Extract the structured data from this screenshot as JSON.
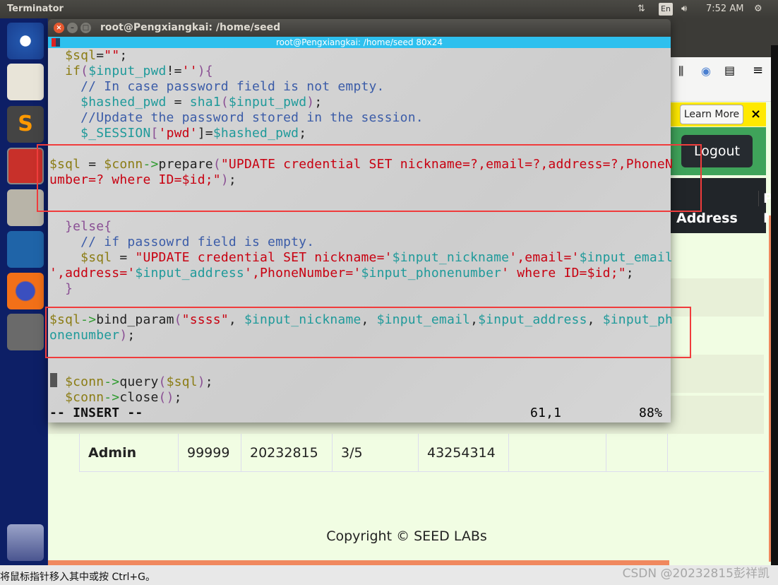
{
  "topbar": {
    "app": "Terminator",
    "keyboard": "En",
    "time": "7:52 AM"
  },
  "launcher": {
    "items": [
      "ubuntu-dash",
      "text-editor",
      "sublime-text",
      "terminator",
      "files",
      "wireshark",
      "firefox",
      "system-settings",
      "trash"
    ]
  },
  "browser": {
    "notification_button": "Learn More",
    "notification_close": "×",
    "logout": "Logout",
    "table_header": [
      "Address",
      "P",
      "N"
    ],
    "admin_row": [
      "Admin",
      "99999",
      "20232815",
      "3/5",
      "43254314",
      "",
      "",
      ""
    ],
    "footer": "Copyright © SEED LABs"
  },
  "terminal": {
    "window_title": "root@Pengxiangkai: /home/seed",
    "tab_title": "root@Pengxiangkai: /home/seed 80x24",
    "lines": [
      [
        [
          "  ",
          "k"
        ],
        [
          "$sql",
          "v"
        ],
        [
          "=",
          "k"
        ],
        [
          "\"\"",
          "s"
        ],
        [
          ";",
          "k"
        ]
      ],
      [
        [
          "  ",
          "k"
        ],
        [
          "if",
          "v"
        ],
        [
          "(",
          "p"
        ],
        [
          "$input_pwd",
          "t"
        ],
        [
          "!=",
          "k"
        ],
        [
          "''",
          "s"
        ],
        [
          ")",
          "p"
        ],
        [
          "{",
          "p"
        ]
      ],
      [
        [
          "    // In case password field is not empty.",
          "c"
        ]
      ],
      [
        [
          "    ",
          "k"
        ],
        [
          "$hashed_pwd",
          "t"
        ],
        [
          " = ",
          "k"
        ],
        [
          "sha1",
          "t"
        ],
        [
          "(",
          "p"
        ],
        [
          "$input_pwd",
          "t"
        ],
        [
          ")",
          "p"
        ],
        [
          ";",
          "k"
        ]
      ],
      [
        [
          "    //Update the password stored in the session.",
          "c"
        ]
      ],
      [
        [
          "    ",
          "k"
        ],
        [
          "$_SESSION",
          "t"
        ],
        [
          "[",
          "p"
        ],
        [
          "'pwd'",
          "s"
        ],
        [
          "]=",
          "k"
        ],
        [
          "$hashed_pwd",
          "t"
        ],
        [
          ";",
          "k"
        ]
      ],
      [],
      [
        [
          "$sql",
          "v"
        ],
        [
          " = ",
          "k"
        ],
        [
          "$conn",
          "v"
        ],
        [
          "->",
          "g"
        ],
        [
          "prepare",
          "k"
        ],
        [
          "(",
          "p"
        ],
        [
          "\"UPDATE credential SET nickname=?,email=?,address=?,PhoneN",
          "s"
        ]
      ],
      [
        [
          "umber=? where ID=$id;\"",
          "s"
        ],
        [
          ")",
          "p"
        ],
        [
          ";",
          "k"
        ]
      ],
      [],
      [],
      [
        [
          "  ",
          "k"
        ],
        [
          "}else{",
          "p"
        ]
      ],
      [
        [
          "    // if passowrd field is empty.",
          "c"
        ]
      ],
      [
        [
          "    ",
          "k"
        ],
        [
          "$sql",
          "v"
        ],
        [
          " = ",
          "k"
        ],
        [
          "\"UPDATE credential SET nickname='",
          "s"
        ],
        [
          "$input_nickname",
          "t"
        ],
        [
          "',email='",
          "s"
        ],
        [
          "$input_email",
          "t"
        ]
      ],
      [
        [
          "',address='",
          "s"
        ],
        [
          "$input_address",
          "t"
        ],
        [
          "',PhoneNumber='",
          "s"
        ],
        [
          "$input_phonenumber",
          "t"
        ],
        [
          "' where ID=$id;\"",
          "s"
        ],
        [
          ";",
          "k"
        ]
      ],
      [
        [
          "  ",
          "k"
        ],
        [
          "}",
          "p"
        ]
      ],
      [],
      [
        [
          "$sql",
          "v"
        ],
        [
          "->",
          "g"
        ],
        [
          "bind_param",
          "k"
        ],
        [
          "(",
          "p"
        ],
        [
          "\"ssss\"",
          "s"
        ],
        [
          ", ",
          "k"
        ],
        [
          "$input_nickname",
          "t"
        ],
        [
          ", ",
          "k"
        ],
        [
          "$input_email",
          "t"
        ],
        [
          ",",
          "k"
        ],
        [
          "$input_address",
          "t"
        ],
        [
          ", ",
          "k"
        ],
        [
          "$input_ph",
          "t"
        ]
      ],
      [
        [
          "onenumber",
          "t"
        ],
        [
          ")",
          "p"
        ],
        [
          ";",
          "k"
        ]
      ],
      [],
      [],
      [
        [
          "  ",
          "k"
        ],
        [
          "$conn",
          "v"
        ],
        [
          "->",
          "g"
        ],
        [
          "query",
          "k"
        ],
        [
          "(",
          "p"
        ],
        [
          "$sql",
          "v"
        ],
        [
          ")",
          "p"
        ],
        [
          ";",
          "k"
        ]
      ],
      [
        [
          "  ",
          "k"
        ],
        [
          "$conn",
          "v"
        ],
        [
          "->",
          "g"
        ],
        [
          "close",
          "k"
        ],
        [
          "()",
          "p"
        ],
        [
          ";",
          "k"
        ]
      ]
    ],
    "mode": "-- INSERT --",
    "position": "61,1",
    "percent": "88%"
  },
  "statusbar": {
    "hint": "将鼠标指针移入其中或按 Ctrl+G。",
    "watermark": "CSDN @20232815彭祥凯"
  },
  "colors": {
    "terminal_tab": "#2ec0ee",
    "navbar": "#3fa35a",
    "highlight": "#f03c3c",
    "page_bg": "#f1fde3"
  }
}
